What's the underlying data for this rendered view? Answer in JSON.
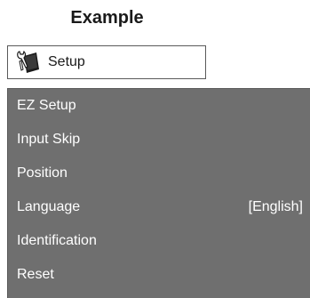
{
  "heading": "Example",
  "tab": {
    "icon": "wrench-screwdriver-icon",
    "label": "Setup"
  },
  "menu": {
    "items": [
      {
        "label": "EZ Setup",
        "value": ""
      },
      {
        "label": "Input Skip",
        "value": ""
      },
      {
        "label": "Position",
        "value": ""
      },
      {
        "label": "Language",
        "value": "[English]"
      },
      {
        "label": "Identification",
        "value": ""
      },
      {
        "label": "Reset",
        "value": ""
      }
    ]
  },
  "colors": {
    "panel_background": "#6f6f6f",
    "menu_text": "#ffffff",
    "tab_border": "#5a5a5a"
  }
}
